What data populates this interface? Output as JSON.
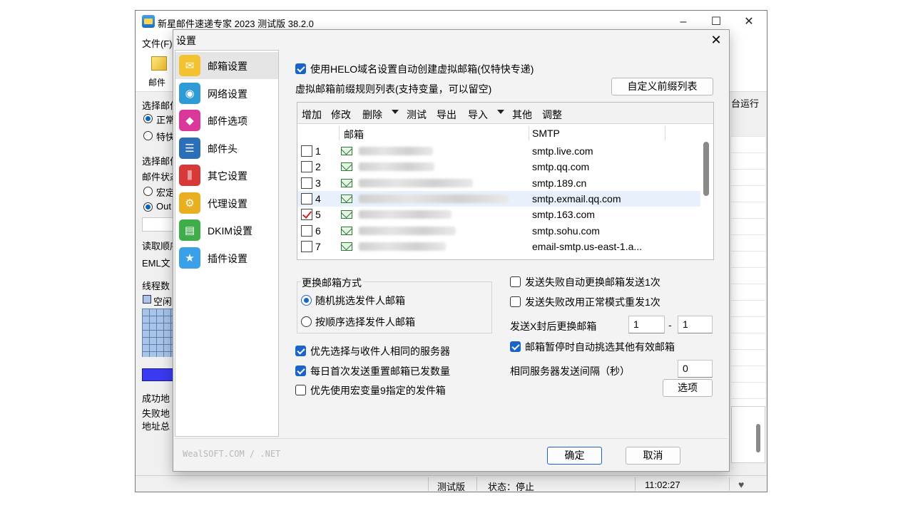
{
  "main_window": {
    "title": "新星邮件速递专家 2023 测试版 38.2.0",
    "menu_file": "文件(F)",
    "toolbar_mail_label": "邮件",
    "run_label": "台运行",
    "left_pane": {
      "select_mail_label": "选择邮件",
      "radio_normal": "正常",
      "radio_express": "特快",
      "select_mail_label2": "选择邮件",
      "mail_status_label": "邮件状态",
      "radio_macro": "宏定",
      "radio_outlook": "Out",
      "read_order_label": "读取顺序",
      "eml_label": "EML文",
      "thread_count_label": "线程数",
      "idle_label": "空闲",
      "success_addr_label": "成功地",
      "fail_addr_label": "失败地",
      "total_addr_label": "地址总"
    },
    "status_bar": {
      "version": "测试版",
      "status": "状态：停止",
      "time": "11:02:27"
    }
  },
  "dialog": {
    "title": "设置",
    "close_glyph": "✕",
    "categories": [
      {
        "label": "邮箱设置",
        "icon": "mailbox-settings-icon",
        "color": "#f2c230",
        "glyph": "✉",
        "selected": true
      },
      {
        "label": "网络设置",
        "icon": "network-settings-icon",
        "color": "#2f9bd6",
        "glyph": "◉",
        "selected": false
      },
      {
        "label": "邮件选项",
        "icon": "mail-options-icon",
        "color": "#d9389a",
        "glyph": "◆",
        "selected": false
      },
      {
        "label": "邮件头",
        "icon": "mail-header-icon",
        "color": "#2a6fb8",
        "glyph": "☰",
        "selected": false
      },
      {
        "label": "其它设置",
        "icon": "other-settings-icon",
        "color": "#d93838",
        "glyph": "⫼",
        "selected": false
      },
      {
        "label": "代理设置",
        "icon": "proxy-settings-icon",
        "color": "#e8b020",
        "glyph": "⚙",
        "selected": false
      },
      {
        "label": "DKIM设置",
        "icon": "dkim-settings-icon",
        "color": "#3fae4a",
        "glyph": "▤",
        "selected": false
      },
      {
        "label": "插件设置",
        "icon": "plugin-settings-icon",
        "color": "#3aa0e8",
        "glyph": "★",
        "selected": false
      }
    ],
    "helo_checkbox": {
      "label": "使用HELO域名设置自动创建虚拟邮箱(仅特快专递)",
      "checked": true
    },
    "prefix_list_label": "虚拟邮箱前缀规则列表(支持变量，可以留空)",
    "custom_prefix_button": "自定义前缀列表",
    "grid_toolbar": {
      "add": "增加",
      "edit": "修改",
      "delete": "删除",
      "test": "测试",
      "export": "导出",
      "import": "导入",
      "other": "其他",
      "adjust": "调整"
    },
    "grid_columns": {
      "mailbox": "邮箱",
      "smtp": "SMTP"
    },
    "grid_rows": [
      {
        "num": "1",
        "smtp": "smtp.live.com",
        "checked": false
      },
      {
        "num": "2",
        "smtp": "smtp.qq.com",
        "checked": false
      },
      {
        "num": "3",
        "smtp": "smtp.189.cn",
        "checked": false
      },
      {
        "num": "4",
        "smtp": "smtp.exmail.qq.com",
        "checked": false
      },
      {
        "num": "5",
        "smtp": "smtp.163.com",
        "checked": true
      },
      {
        "num": "6",
        "smtp": "smtp.sohu.com",
        "checked": false
      },
      {
        "num": "7",
        "smtp": "email-smtp.us-east-1.a...",
        "checked": false
      }
    ],
    "switch_group": {
      "title": "更换邮箱方式",
      "random_option": "随机挑选发件人邮箱",
      "sequential_option": "按顺序选择发件人邮箱",
      "selected": "random"
    },
    "prefer_same_server": {
      "label": "优先选择与收件人相同的服务器",
      "checked": true
    },
    "daily_reset": {
      "label": "每日首次发送重置邮箱已发数量",
      "checked": true
    },
    "macro9_box": {
      "label": "优先使用宏变量9指定的发件箱",
      "checked": false
    },
    "auto_switch_on_fail": {
      "label": "发送失败自动更换邮箱发送1次",
      "checked": false
    },
    "normal_mode_resend": {
      "label": "发送失败改用正常模式重发1次",
      "checked": false
    },
    "switch_after_x": {
      "label": "发送X封后更换邮箱",
      "from": "1",
      "dash": "-",
      "to": "1"
    },
    "auto_pick_on_pause": {
      "label": "邮箱暂停时自动挑选其他有效邮箱",
      "checked": true
    },
    "same_server_interval": {
      "label": "相同服务器发送间隔（秒）",
      "value": "0"
    },
    "options_button": "选项",
    "watermark": "WealSOFT.COM / .NET",
    "ok_button": "确定",
    "cancel_button": "取消"
  }
}
